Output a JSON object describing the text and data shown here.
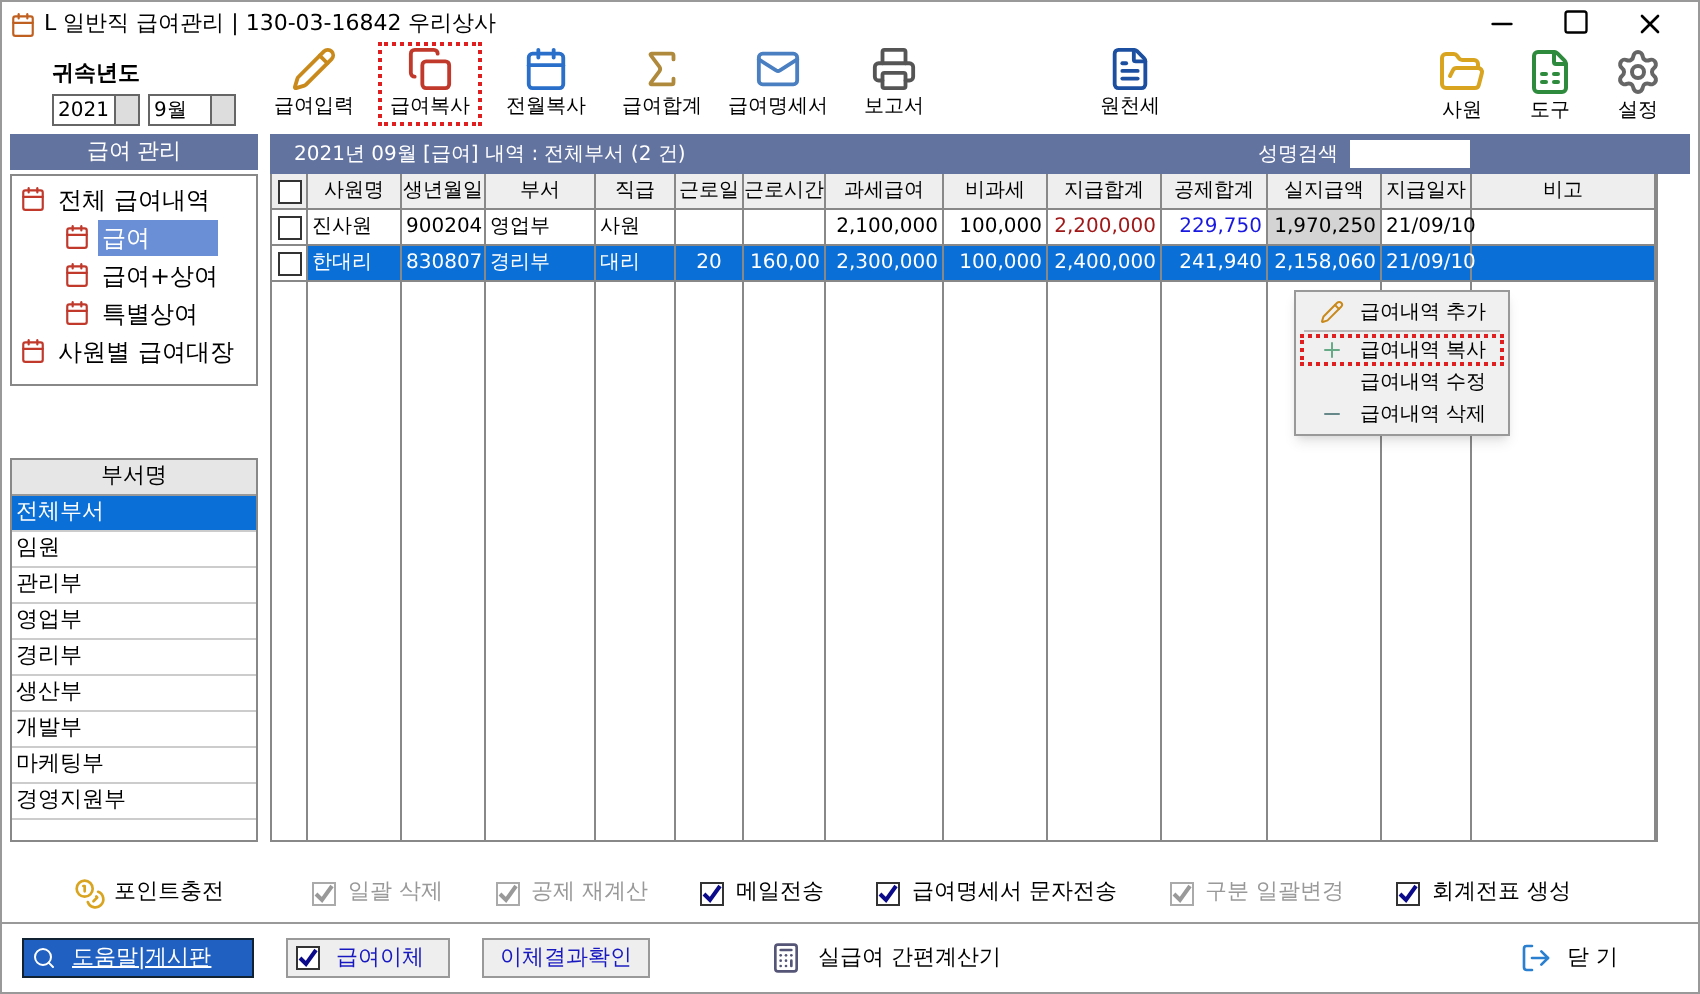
{
  "window": {
    "title": "L 일반직 급여관리 | 130-03-16842  우리상사"
  },
  "period": {
    "label": "귀속년도",
    "year": "2021",
    "month": "9월"
  },
  "toolbar": [
    {
      "label": "급여입력",
      "highlighted": false
    },
    {
      "label": "급여복사",
      "highlighted": true
    },
    {
      "label": "전월복사",
      "highlighted": false
    },
    {
      "label": "급여합계",
      "highlighted": false
    },
    {
      "label": "급여명세서",
      "highlighted": false
    },
    {
      "label": "보고서",
      "highlighted": false
    },
    {
      "label": "원천세",
      "highlighted": false
    }
  ],
  "toolbar_right": [
    {
      "label": "사원"
    },
    {
      "label": "도구"
    },
    {
      "label": "설정"
    }
  ],
  "sidebar": {
    "title": "급여 관리",
    "tree": [
      {
        "label": "전체 급여내역",
        "selected": false,
        "children": [
          {
            "label": "급여",
            "selected": true
          },
          {
            "label": "급여+상여",
            "selected": false
          },
          {
            "label": "특별상여",
            "selected": false
          }
        ]
      },
      {
        "label": "사원별 급여대장",
        "selected": false
      }
    ],
    "departments_title": "부서명",
    "departments": [
      {
        "label": "전체부서",
        "selected": true
      },
      {
        "label": "임원",
        "selected": false
      },
      {
        "label": "관리부",
        "selected": false
      },
      {
        "label": "영업부",
        "selected": false
      },
      {
        "label": "경리부",
        "selected": false
      },
      {
        "label": "생산부",
        "selected": false
      },
      {
        "label": "개발부",
        "selected": false
      },
      {
        "label": "마케팅부",
        "selected": false
      },
      {
        "label": "경영지원부",
        "selected": false
      }
    ]
  },
  "grid": {
    "caption": "2021년 09월 [급여] 내역 : 전체부서  (2 건)",
    "search_label": "성명검색",
    "all_checked": false,
    "columns": [
      {
        "label": "사원명"
      },
      {
        "label": "생년월일"
      },
      {
        "label": "부서"
      },
      {
        "label": "직급"
      },
      {
        "label": "근로일"
      },
      {
        "label": "근로시간"
      },
      {
        "label": "과세급여"
      },
      {
        "label": "비과세"
      },
      {
        "label": "지급합계",
        "color": "#a01818"
      },
      {
        "label": "공제합계",
        "color": "#1818e0"
      },
      {
        "label": "실지급액",
        "shaded": true
      },
      {
        "label": "지급일자"
      },
      {
        "label": "비고"
      }
    ],
    "rows": [
      {
        "selected": false,
        "checked": false,
        "cells": [
          "진사원",
          "900204",
          "영업부",
          "사원",
          "",
          "",
          "2,100,000",
          "100,000",
          "2,200,000",
          "229,750",
          "1,970,250",
          "21/09/10",
          ""
        ]
      },
      {
        "selected": true,
        "checked": false,
        "cells": [
          "한대리",
          "830807",
          "경리부",
          "대리",
          "20",
          "160,00",
          "2,300,000",
          "100,000",
          "2,400,000",
          "241,940",
          "2,158,060",
          "21/09/10",
          ""
        ]
      }
    ]
  },
  "context_menu": [
    {
      "label": "급여내역 추가",
      "highlighted": false
    },
    {
      "label": "급여내역 복사",
      "highlighted": true
    },
    {
      "label": "급여내역 수정",
      "highlighted": false
    },
    {
      "label": "급여내역 삭제",
      "highlighted": false
    }
  ],
  "options": {
    "point_button": "포인트충전",
    "checks": [
      {
        "label": "일괄 삭제",
        "checked": true,
        "disabled": true
      },
      {
        "label": "공제 재계산",
        "checked": true,
        "disabled": true
      },
      {
        "label": "메일전송",
        "checked": true,
        "disabled": false
      },
      {
        "label": "급여명세서 문자전송",
        "checked": true,
        "disabled": false
      },
      {
        "label": "구분 일괄변경",
        "checked": true,
        "disabled": true
      },
      {
        "label": "회계전표 생성",
        "checked": true,
        "disabled": false
      }
    ]
  },
  "bottom": {
    "help": "도움말|게시판",
    "transfer": {
      "label": "급여이체",
      "checked": true
    },
    "result": "이체결과확인",
    "calculator": "실급여 간편계산기",
    "close": "닫 기"
  }
}
